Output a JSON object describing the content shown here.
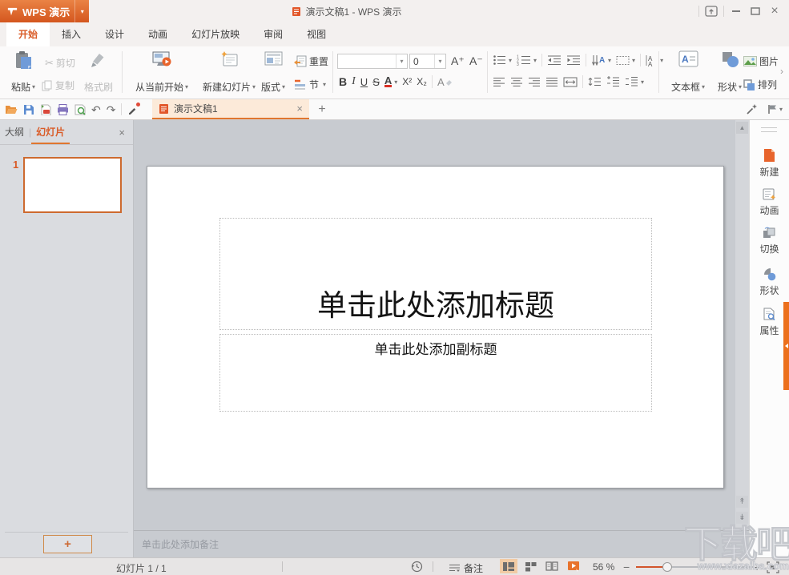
{
  "icons": {
    "dropdown": "▾",
    "close": "×",
    "add": "+",
    "cut": "✂",
    "undo": "↶",
    "redo": "↷",
    "chevron_right": "›",
    "scroll_up": "▲",
    "prev_slide": "↟",
    "next_slide": "↡",
    "minus": "−",
    "plus": "+",
    "bar": "|"
  },
  "titlebar": {
    "app_name": "WPS 演示",
    "doc_title": "演示文稿1 - WPS 演示"
  },
  "ribbon_tabs": [
    {
      "label": "开始",
      "active": true
    },
    {
      "label": "插入"
    },
    {
      "label": "设计"
    },
    {
      "label": "动画"
    },
    {
      "label": "幻灯片放映"
    },
    {
      "label": "审阅"
    },
    {
      "label": "视图"
    }
  ],
  "ribbon": {
    "clipboard": {
      "paste": "粘贴",
      "cut": "剪切",
      "copy": "复制",
      "format_painter": "格式刷"
    },
    "slides": {
      "from_current": "从当前开始",
      "new_slide": "新建幻灯片",
      "layout": "版式",
      "reset": "重置",
      "section": "节"
    },
    "font": {
      "name_value": "",
      "size_value": "0",
      "increase": "A⁺",
      "decrease": "A⁻",
      "bold": "B",
      "italic": "I",
      "underline": "U",
      "strikethrough": "S",
      "color": "A",
      "superscript": "X²",
      "subscript": "X₂",
      "clear": "A"
    },
    "insert": {
      "textbox": "文本框",
      "shapes": "形状",
      "picture": "图片",
      "arrange": "排列"
    }
  },
  "tabbar": {
    "doc_tab": "演示文稿1"
  },
  "left_panel": {
    "outline_tab": "大纲",
    "slides_tab": "幻灯片",
    "slide_number": "1"
  },
  "slide": {
    "title_placeholder": "单击此处添加标题",
    "subtitle_placeholder": "单击此处添加副标题"
  },
  "notes": {
    "placeholder": "单击此处添加备注"
  },
  "sidebar": {
    "items": [
      {
        "label": "新建"
      },
      {
        "label": "动画"
      },
      {
        "label": "切换"
      },
      {
        "label": "形状"
      },
      {
        "label": "属性"
      }
    ]
  },
  "statusbar": {
    "slide_counter": "幻灯片 1 / 1",
    "notes_label": "备注",
    "zoom_value": "56 %"
  },
  "watermark": {
    "text": "下载吧",
    "site": "www.xiazaiba.com"
  },
  "colors": {
    "accent": "#d95b27",
    "logo_top": "#ea8345",
    "logo_bottom": "#d4561e",
    "active_doc_tab_bg": "#fcead9",
    "doc_tab_border": "#e0762f",
    "thumb_border": "#cd6a2f",
    "sidebar_strip": "#ec701c",
    "view_active_bg": "#f2cba4",
    "slider_fill": "#d2552c",
    "font_color_bar": "#d93025"
  }
}
